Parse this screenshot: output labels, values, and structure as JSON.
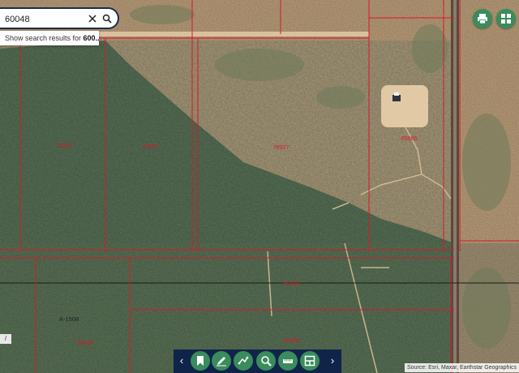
{
  "search": {
    "value": "60048",
    "suggestion_prefix": "Show search results for ",
    "suggestion_term": "600..."
  },
  "map": {
    "parcel_labels": [
      "78327",
      "78326",
      "78327",
      "65985",
      "60048",
      "60048",
      "A-1508",
      "60048"
    ],
    "attribution": "Source: Esri, Maxar, Earthstar Geographics"
  },
  "side_tab": {
    "label": "/"
  },
  "toolbar": {
    "prev": "‹",
    "next": "›",
    "buttons": [
      "bookmark-icon",
      "draw-icon",
      "measure-icon",
      "zoom-search-icon",
      "ruler-icon",
      "layers-icon"
    ]
  },
  "top_right": {
    "buttons": [
      "print-icon",
      "grid-icon"
    ]
  },
  "colors": {
    "accent_green": "#3a8c5c",
    "navy": "#10244a",
    "parcel_line": "#d8192a",
    "desert": "#c8a982",
    "vegetation": "#4f6a4c"
  }
}
